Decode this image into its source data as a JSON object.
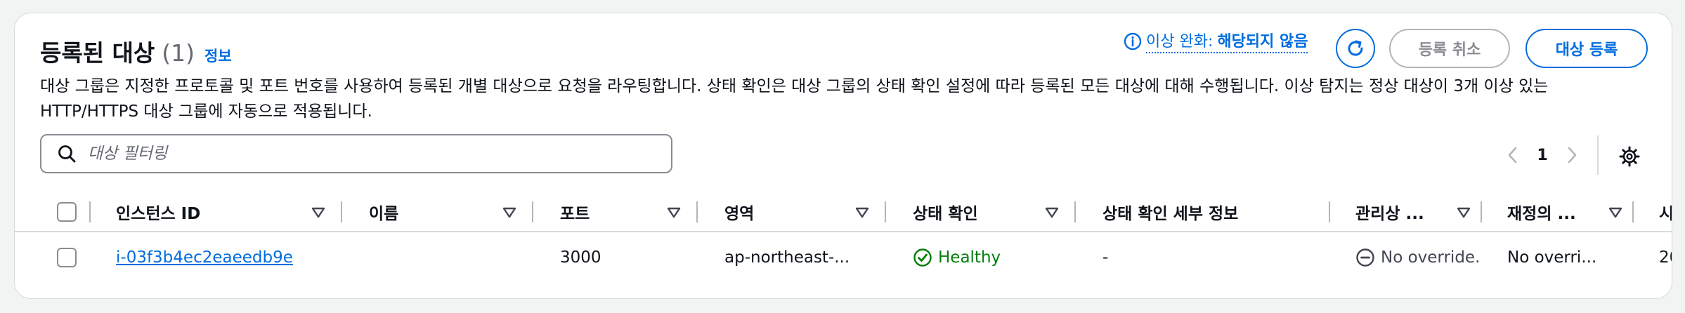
{
  "header": {
    "title": "등록된 대상",
    "count": "(1)",
    "info_link": "정보",
    "description": "대상 그룹은 지정한 프로토콜 및 포트 번호를 사용하여 등록된 개별 대상으로 요청을 라우팅합니다. 상태 확인은 대상 그룹의 상태 확인 설정에 따라 등록된 모든 대상에 대해 수행됩니다. 이상 탐지는 정상 대상이 3개 이상 있는 HTTP/HTTPS 대상 그룹에 자동으로 적용됩니다."
  },
  "anomaly_mitigation": {
    "label": "이상 완화:",
    "value": "해당되지 않음"
  },
  "actions": {
    "deregister": "등록 취소",
    "register": "대상 등록"
  },
  "filter": {
    "placeholder": "대상 필터링"
  },
  "pagination": {
    "current_page": "1"
  },
  "table": {
    "columns": [
      "인스턴스 ID",
      "이름",
      "포트",
      "영역",
      "상태 확인",
      "상태 확인 세부 정보",
      "관리상 ...",
      "재정의 ...",
      "시"
    ],
    "rows": [
      {
        "instance_id": "i-03f3b4ec2eaeedb9e",
        "name": "",
        "port": "3000",
        "zone": "ap-northeast-...",
        "health": "Healthy",
        "health_details": "-",
        "admin_override": "No override.",
        "override": "No overri...",
        "launch": "20"
      }
    ]
  },
  "colors": {
    "accent": "#006ce0",
    "healthy": "#037f0c",
    "disabled": "#8c8c94",
    "border": "#d5dbdb"
  },
  "icons": [
    "info-icon",
    "refresh-icon",
    "search-icon",
    "chevron-left-icon",
    "chevron-right-icon",
    "settings-gear-icon",
    "sort-down-icon",
    "success-check-icon",
    "minus-circle-icon"
  ]
}
